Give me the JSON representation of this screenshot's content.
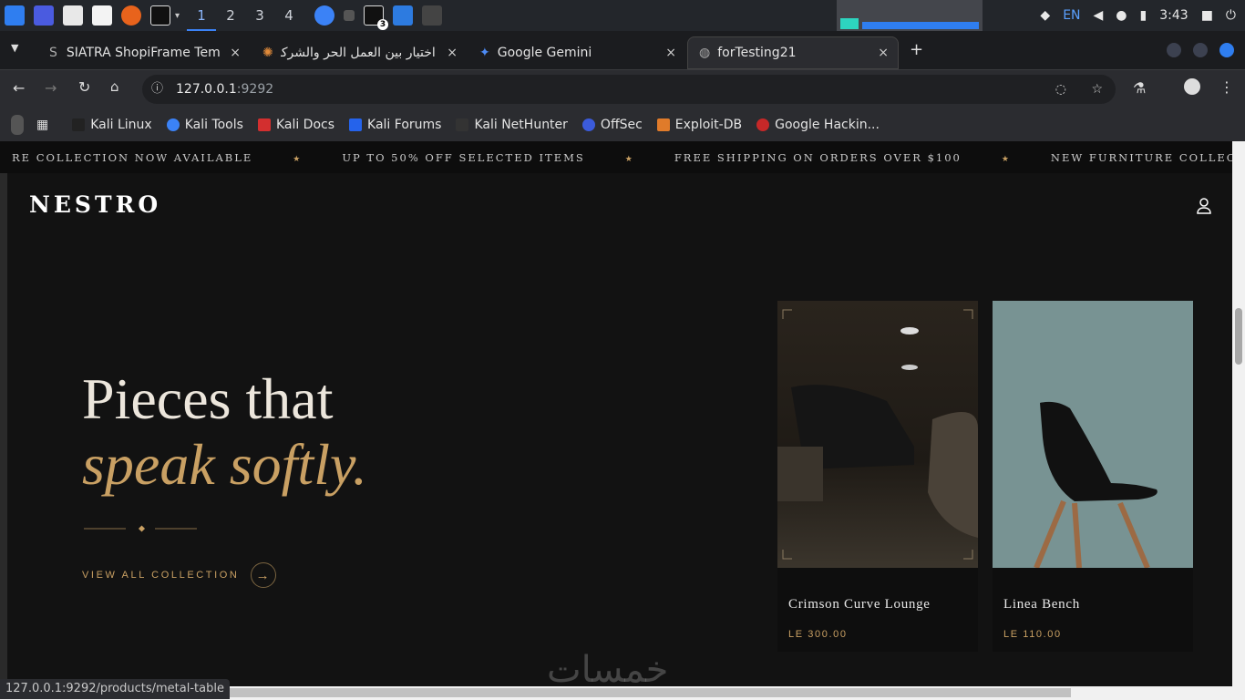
{
  "taskbar": {
    "workspaces": [
      "1",
      "2",
      "3",
      "4"
    ],
    "active_workspace": "1",
    "terminal_badge": "3",
    "tray": {
      "lang": "EN",
      "clock": "3:43"
    }
  },
  "browser": {
    "tabs": [
      {
        "label": "SIATRA ShopiFrame Tem",
        "favicon": "S"
      },
      {
        "label": "اختيار بين العمل الحر والشركة"
      },
      {
        "label": "Google Gemini"
      },
      {
        "label": "forTesting21",
        "active": true
      }
    ],
    "close_glyph": "×",
    "new_tab_glyph": "+",
    "url_host": "127.0.0.1",
    "url_port": ":9292",
    "bookmarks": [
      "Kali Linux",
      "Kali Tools",
      "Kali Docs",
      "Kali Forums",
      "Kali NetHunter",
      "OffSec",
      "Exploit-DB",
      "Google Hackin..."
    ],
    "status_url": "127.0.0.1:9292/products/metal-table"
  },
  "page": {
    "announcements": [
      "RE COLLECTION NOW AVAILABLE",
      "UP TO 50% OFF SELECTED ITEMS",
      "FREE SHIPPING ON ORDERS OVER $100",
      "NEW FURNITURE COLLECTION NOW AVAILABLE"
    ],
    "star_glyph": "★",
    "brand": "NESTRO",
    "hero": {
      "line1": "Pieces that",
      "line2": "speak softly.",
      "cta": "VIEW ALL COLLECTION",
      "cta_arrow": "→"
    },
    "products": [
      {
        "name": "Crimson Curve Lounge",
        "price": "LE 300.00"
      },
      {
        "name": "Linea Bench",
        "price": "LE 110.00"
      }
    ],
    "accent": "#c9a063",
    "watermark": "خمسات"
  }
}
